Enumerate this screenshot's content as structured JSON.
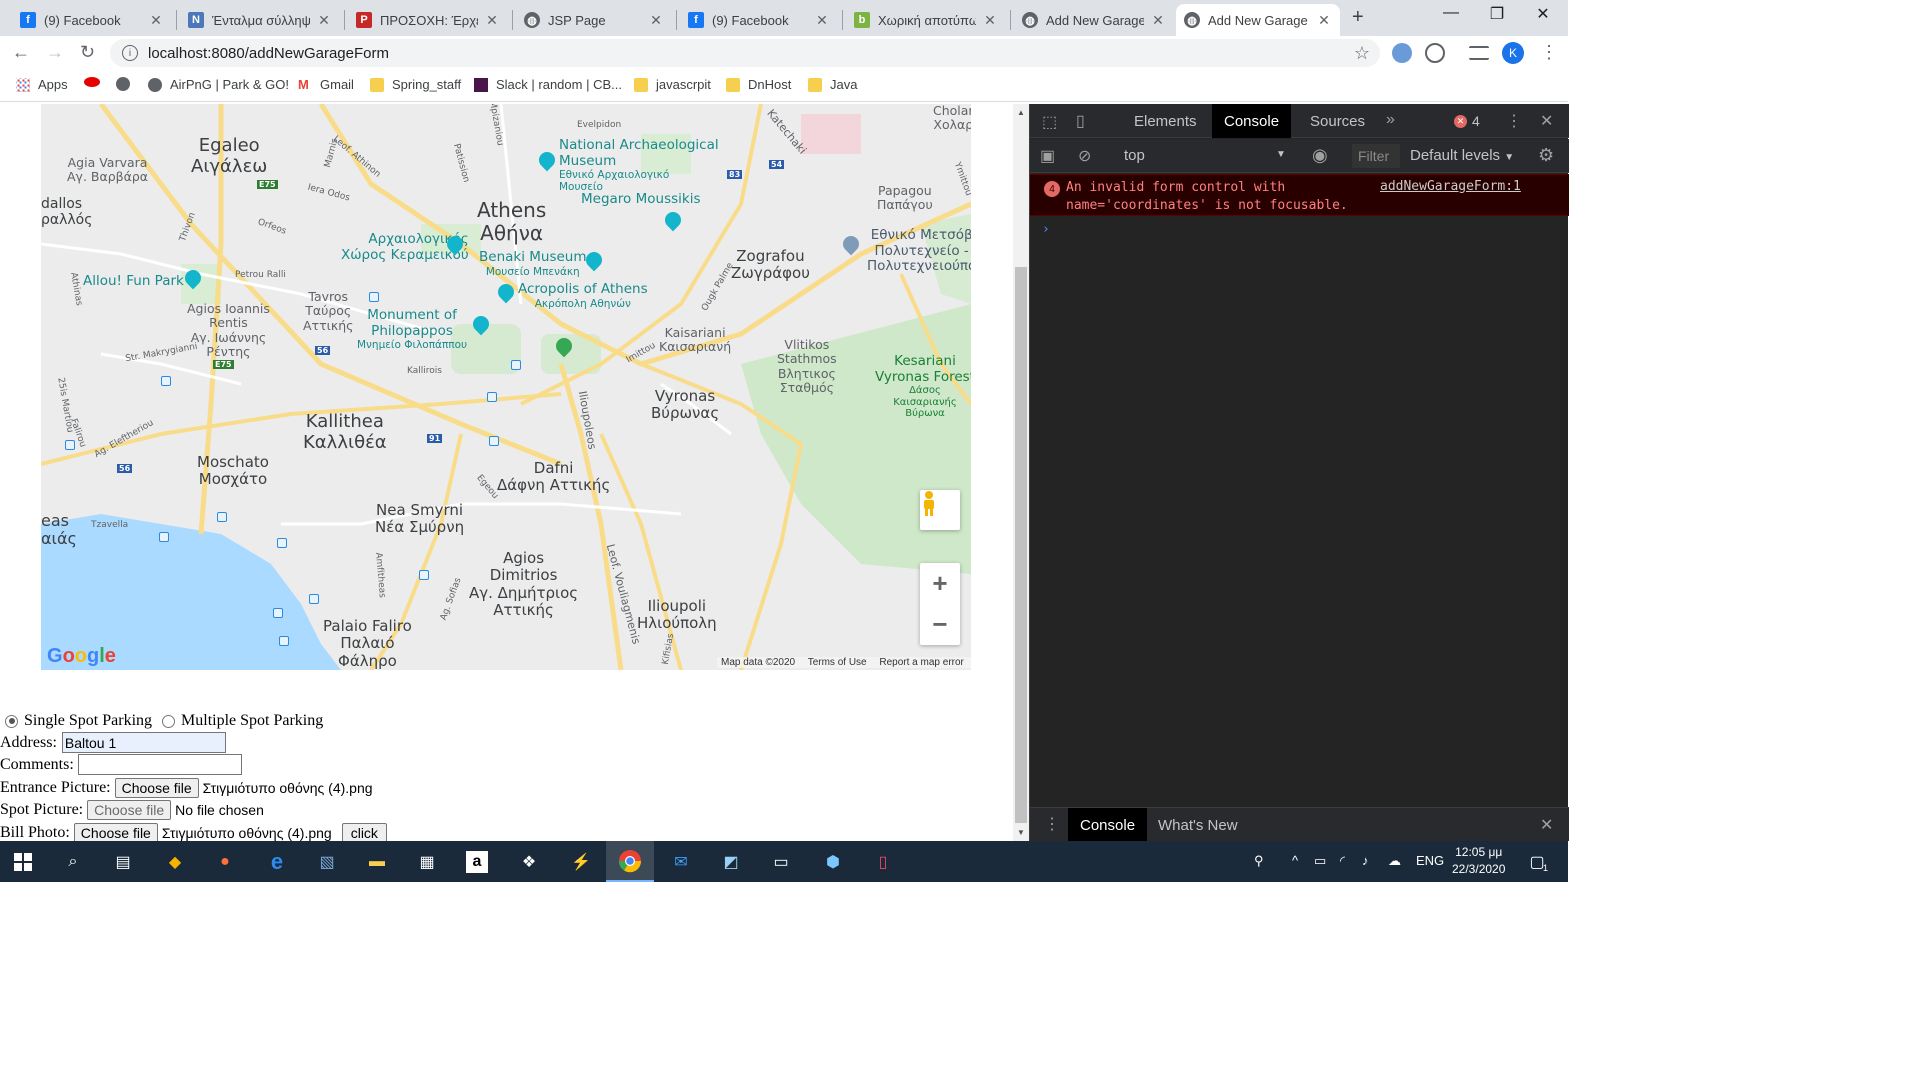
{
  "browser": {
    "tabs": [
      {
        "title": "(9) Facebook",
        "icon": "facebook-icon",
        "color": "#1877f2"
      },
      {
        "title": "Ένταλμα σύλληψη",
        "icon": "ntua-icon",
        "color": "#4a78b8"
      },
      {
        "title": "ΠΡΟΣΟΧΗ: Έρχετα",
        "icon": "news-icon",
        "color": "#c62828"
      },
      {
        "title": "JSP Page",
        "icon": "globe-icon",
        "color": "#5f6368"
      },
      {
        "title": "(9) Facebook",
        "icon": "facebook-icon",
        "color": "#1877f2"
      },
      {
        "title": "Χωρική αποτύπωσ",
        "icon": "app-icon",
        "color": "#7cb342"
      },
      {
        "title": "Add New Garage",
        "icon": "globe-icon",
        "color": "#5f6368"
      },
      {
        "title": "Add New Garage",
        "icon": "globe-icon",
        "color": "#5f6368",
        "active": true
      }
    ],
    "url": "localhost:8080/addNewGarageForm",
    "avatar_letter": "K",
    "bookmarks": [
      {
        "label": "Apps",
        "icon": "apps-grid-icon"
      },
      {
        "label": "",
        "icon": "vodafone-icon"
      },
      {
        "label": "",
        "icon": "globe-icon"
      },
      {
        "label": "AirPnG | Park & GO!",
        "icon": "globe-icon"
      },
      {
        "label": "Gmail",
        "icon": "gmail-icon"
      },
      {
        "label": "Spring_staff",
        "icon": "folder-icon"
      },
      {
        "label": "Slack | random | CB...",
        "icon": "slack-icon"
      },
      {
        "label": "javascrpit",
        "icon": "folder-icon"
      },
      {
        "label": "DnHost",
        "icon": "folder-icon"
      },
      {
        "label": "Java",
        "icon": "folder-icon"
      }
    ]
  },
  "map": {
    "places": [
      {
        "t": "Cholar\nΧολαρ",
        "cls": "sm"
      },
      {
        "t": "Egaleo\nΑιγάλεω",
        "cls": "big"
      },
      {
        "t": "Agia Varvara\nΑγ. Βαρβάρα",
        "cls": "sm"
      },
      {
        "t": "dallos\nραλλός",
        "cls": "med"
      },
      {
        "t": "Athens\nΑθήνα",
        "cls": "big"
      },
      {
        "t": "Papagou\nΠαπάγου",
        "cls": "sm"
      },
      {
        "t": "Zografou\nΖωγράφου",
        "cls": "med"
      },
      {
        "t": "Tavros\nΤαύρος\nΑττικής",
        "cls": "sm"
      },
      {
        "t": "Agios Ioannis\nRentis\nΑγ. Ιωάννης\nΡέντης",
        "cls": "sm"
      },
      {
        "t": "Kaisariani\nΚαισαριανή",
        "cls": "sm"
      },
      {
        "t": "Vlitikos\nStathmos\nΒλητικος\nΣταθμός",
        "cls": "sm"
      },
      {
        "t": "Vyronas\nΒύρωνας",
        "cls": "med"
      },
      {
        "t": "Kallithea\nΚαλλιθέα",
        "cls": "big"
      },
      {
        "t": "Moschato\nΜοσχάτο",
        "cls": "med"
      },
      {
        "t": "Dafni\nΔάφνη Αττικής",
        "cls": "med"
      },
      {
        "t": "Nea Smyrni\nΝέα Σμύρνη",
        "cls": "med"
      },
      {
        "t": "eas\nαιάς",
        "cls": "med"
      },
      {
        "t": "Agios\nDimitrios\nΑγ. Δημήτριος\nΑττικής",
        "cls": "med"
      },
      {
        "t": "Ilioupoli\nΗλιούπολη",
        "cls": "med"
      },
      {
        "t": "Palaio Faliro\nΠαλαιό\nΦάληρο",
        "cls": "med"
      }
    ],
    "pois": [
      {
        "t": "National Archaeological\nMuseum",
        "sub": "Εθνικό Αρχαιολογικό\nΜουσείο"
      },
      {
        "t": "Megaro Moussikis",
        "sub": ""
      },
      {
        "t": "Αρχαιολογικός\nΧώρος Κεραμεικού",
        "sub": ""
      },
      {
        "t": "Benaki Museum",
        "sub": "Μουσείο Μπενάκη"
      },
      {
        "t": "Acropolis of Athens",
        "sub": "Ακρόπολη Αθηνών"
      },
      {
        "t": "Monument of\nPhilopappos",
        "sub": "Μνημείο Φιλοπάππου"
      },
      {
        "t": "Εθνικό Μετσόβ\nΠολυτεχνείο -\nΠολυτεχνειούπο",
        "sub": ""
      }
    ],
    "parks": [
      {
        "t": "Allou! Fun Park",
        "sub": ""
      },
      {
        "t": "Kesariani\nVyronas Forest",
        "sub": "Δάσος\nΚαισαριανής\nΒύρωνα"
      }
    ],
    "roads": [
      "Leof. Athinon",
      "Katechaki",
      "Evelpidon",
      "Iera Odos",
      "Orfeos",
      "Thivon",
      "Petrou Ralli",
      "Patission",
      "Marnis",
      "Ilioupoleos",
      "Leof. Vouliagmenis",
      "Str. Makrygianni",
      "Egeou",
      "Tzavella",
      "Kallirois",
      "Imittou",
      "Ag. Eleftheriou",
      "Amfitheas",
      "Ag. Sofias",
      "Mpizaniou",
      "Athinas",
      "Ymittou",
      "25is Martiou",
      "Falirou",
      "Ougk Palme",
      "Kifisias"
    ],
    "shields": [
      "E75",
      "E75",
      "54",
      "83",
      "56",
      "56",
      "91"
    ],
    "footer": {
      "data": "Map data ©2020",
      "terms": "Terms of Use",
      "report": "Report a map error"
    }
  },
  "form": {
    "radio_single": "Single Spot Parking",
    "radio_multiple": "Multiple Spot Parking",
    "address_label": "Address:",
    "address_value": "Baltou 1",
    "comments_label": "Comments:",
    "comments_value": "",
    "entrance_label": "Entrance Picture:",
    "entrance_btn": "Choose file",
    "entrance_file": "Στιγμιότυπο οθόνης (4).png",
    "spot_label": "Spot Picture:",
    "spot_btn": "Choose file",
    "spot_file": "No file chosen",
    "bill_label": "Bill Photo:",
    "bill_btn": "Choose file",
    "bill_file": "Στιγμιότυπο οθόνης (4).png",
    "click_btn": "click"
  },
  "devtools": {
    "tabs": [
      "Elements",
      "Console",
      "Sources"
    ],
    "error_count": "4",
    "context": "top",
    "filter_placeholder": "Filter",
    "levels": "Default levels",
    "error": {
      "count": "4",
      "message": "An invalid form control with\nname='coordinates' is not focusable.",
      "source": "addNewGarageForm:1"
    },
    "drawer_tabs": [
      "Console",
      "What's New"
    ]
  },
  "taskbar": {
    "lang": "ENG",
    "time": "12:05 μμ",
    "date": "22/3/2020",
    "notifications": "1"
  }
}
